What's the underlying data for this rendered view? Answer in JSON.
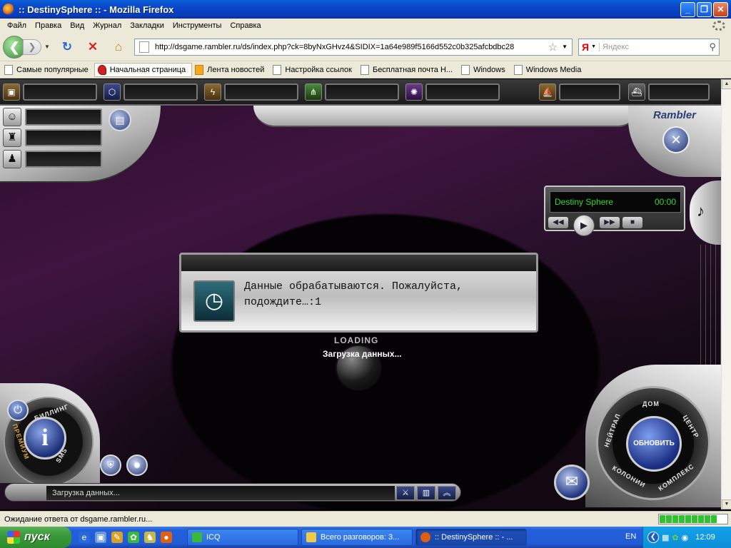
{
  "window": {
    "title": ":: DestinySphere :: - Mozilla Firefox",
    "minimize": "_",
    "maximize": "❐",
    "close": "✕"
  },
  "menu": [
    "Файл",
    "Правка",
    "Вид",
    "Журнал",
    "Закладки",
    "Инструменты",
    "Справка"
  ],
  "nav": {
    "url": "http://dsgame.rambler.ru/ds/index.php?ck=8byNxGHvz4&SIDIX=1a64e989f5166d552c0b325afcbdbc28",
    "search_logo": "Я",
    "search_placeholder": "Яндекс"
  },
  "bookmarks": [
    {
      "label": "Самые популярные",
      "icon": "page-icon"
    },
    {
      "label": "Начальная страница",
      "icon": "rambler-icon"
    },
    {
      "label": "Лента новостей",
      "icon": "rss-icon"
    },
    {
      "label": "Настройка ссылок",
      "icon": "page-icon"
    },
    {
      "label": "Бесплатная почта Н...",
      "icon": "page-icon"
    },
    {
      "label": "Windows",
      "icon": "page-icon"
    },
    {
      "label": "Windows Media",
      "icon": "page-icon"
    }
  ],
  "game": {
    "brand": "Rambler",
    "player": {
      "track": "Destiny Sphere",
      "time": "00:00"
    },
    "dialog": {
      "message": "Данные обрабатываются. Пожалуйста, подождите…:1"
    },
    "loading_label": "LOADING",
    "loading_text": "Загрузка данных...",
    "left_ring": {
      "billing": "БИЛЛИНГ",
      "premium": "ПРЕМИУМ",
      "sms": "SMS",
      "info": "i"
    },
    "right_ring": {
      "home": "ДОМ",
      "center": "ЦЕНТР",
      "complex": "КОМПЛЕКС",
      "colonies": "КОЛОНИИ",
      "neutral": "НЕЙТРАЛ",
      "refresh": "ОБНОВИТЬ"
    },
    "status_text": "Загрузка данных..."
  },
  "statusbar": {
    "text": "Ожидание ответа от dsgame.rambler.ru...",
    "progress": 0.9
  },
  "taskbar": {
    "start": "пуск",
    "tasks": [
      {
        "label": "ICQ",
        "icon": "icq-icon"
      },
      {
        "label": "Всего разговоров: 3...",
        "icon": "folder-icon"
      },
      {
        "label": ":: DestinySphere :: - ...",
        "icon": "firefox-icon"
      }
    ],
    "lang": "EN",
    "clock": "12:09"
  }
}
